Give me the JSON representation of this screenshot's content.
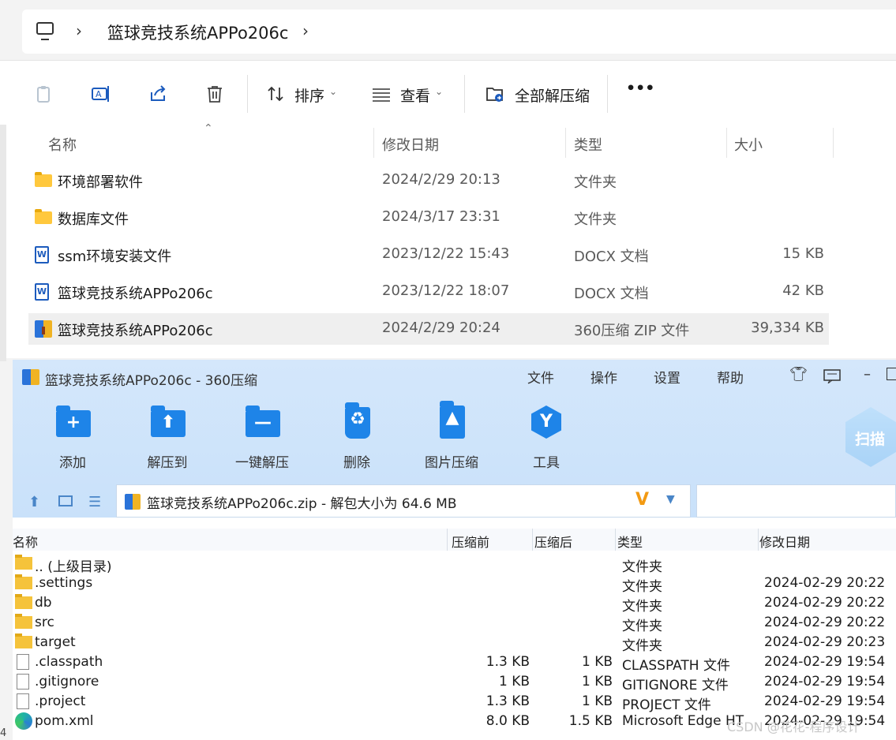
{
  "address": {
    "crumb": "篮球竞技系统APPo206c"
  },
  "toolbar": {
    "sort_label": "排序",
    "view_label": "查看",
    "extract_all_label": "全部解压缩",
    "more_label": "•••"
  },
  "columns": {
    "name": "名称",
    "date": "修改日期",
    "type": "类型",
    "size": "大小"
  },
  "files": [
    {
      "name": "环境部署软件",
      "date": "2024/2/29 20:13",
      "type": "文件夹",
      "size": "",
      "icon": "folder-icon"
    },
    {
      "name": "数据库文件",
      "date": "2024/3/17 23:31",
      "type": "文件夹",
      "size": "",
      "icon": "folder-icon"
    },
    {
      "name": "ssm环境安装文件",
      "date": "2023/12/22 15:43",
      "type": "DOCX 文档",
      "size": "15 KB",
      "icon": "word-doc-icon"
    },
    {
      "name": "篮球竞技系统APPo206c",
      "date": "2023/12/22 18:07",
      "type": "DOCX 文档",
      "size": "42 KB",
      "icon": "word-doc-icon"
    },
    {
      "name": "篮球竞技系统APPo206c",
      "date": "2024/2/29 20:24",
      "type": "360压缩 ZIP 文件",
      "size": "39,334 KB",
      "icon": "zip-icon",
      "selected": true
    }
  ],
  "zipwin": {
    "title": "篮球竞技系统APPo206c - 360压缩",
    "menu": [
      "文件",
      "操作",
      "设置",
      "帮助"
    ],
    "buttons": [
      {
        "label": "添加",
        "glyph": "+"
      },
      {
        "label": "解压到",
        "glyph": "⬆"
      },
      {
        "label": "一键解压",
        "glyph": "—"
      },
      {
        "label": "删除",
        "glyph": "♻"
      },
      {
        "label": "图片压缩",
        "glyph": "▲"
      },
      {
        "label": "工具",
        "glyph": "Y"
      }
    ],
    "scan_label": "扫描",
    "path": "篮球竞技系统APPo206c.zip - 解包大小为 64.6 MB",
    "columns": {
      "name": "名称",
      "before": "压缩前",
      "after": "压缩后",
      "type": "类型",
      "date": "修改日期"
    },
    "rows": [
      {
        "name": ".. (上级目录)",
        "before": "",
        "after": "",
        "type": "文件夹",
        "date": "",
        "icon": "folder-icon"
      },
      {
        "name": ".settings",
        "before": "",
        "after": "",
        "type": "文件夹",
        "date": "2024-02-29 20:22",
        "icon": "folder-icon"
      },
      {
        "name": "db",
        "before": "",
        "after": "",
        "type": "文件夹",
        "date": "2024-02-29 20:22",
        "icon": "folder-icon"
      },
      {
        "name": "src",
        "before": "",
        "after": "",
        "type": "文件夹",
        "date": "2024-02-29 20:22",
        "icon": "folder-icon"
      },
      {
        "name": "target",
        "before": "",
        "after": "",
        "type": "文件夹",
        "date": "2024-02-29 20:23",
        "icon": "folder-icon"
      },
      {
        "name": ".classpath",
        "before": "1.3 KB",
        "after": "1 KB",
        "type": "CLASSPATH 文件",
        "date": "2024-02-29 19:54",
        "icon": "file-icon"
      },
      {
        "name": ".gitignore",
        "before": "1 KB",
        "after": "1 KB",
        "type": "GITIGNORE 文件",
        "date": "2024-02-29 19:54",
        "icon": "file-icon"
      },
      {
        "name": ".project",
        "before": "1.3 KB",
        "after": "1 KB",
        "type": "PROJECT 文件",
        "date": "2024-02-29 19:54",
        "icon": "file-icon"
      },
      {
        "name": "pom.xml",
        "before": "8.0 KB",
        "after": "1.5 KB",
        "type": "Microsoft Edge HT",
        "date": "2024-02-29 19:54",
        "icon": "edge-icon"
      }
    ]
  },
  "watermark": "CSDN @花花-程序设计",
  "edge_fragment": "4"
}
